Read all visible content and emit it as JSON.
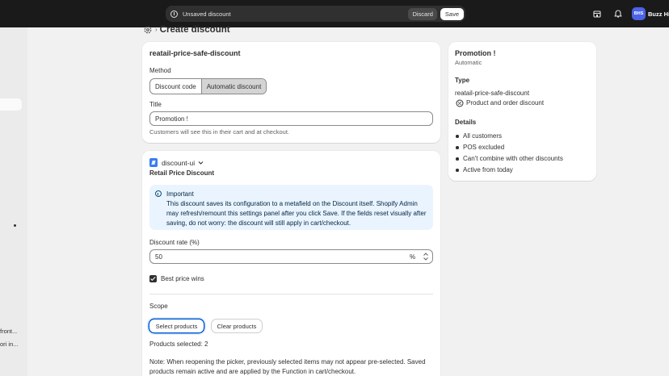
{
  "topbar": {
    "unsaved_title": "Unsaved discount",
    "discard_label": "Discard",
    "save_label": "Save",
    "avatar_initials": "BHS",
    "shop_name": "Buzz Hi"
  },
  "sidebar": {
    "snippets": [
      "front...",
      "ori in..."
    ]
  },
  "header": {
    "title": "Create discount"
  },
  "method_card": {
    "discount_name": "reatail-price-safe-discount",
    "method_label": "Method",
    "method_options": [
      "Discount code",
      "Automatic discount"
    ],
    "method_selected": "Automatic discount",
    "title_label": "Title",
    "title_value": "Promotion !",
    "title_help": "Customers will see this in their cart and at checkout."
  },
  "app_card": {
    "app_name": "discount-ui",
    "heading": "Retail Price Discount",
    "banner_title": "Important",
    "banner_text": "This discount saves its configuration to a metafield on the Discount itself. Shopify Admin may refresh/remount this settings panel after you click Save. If the fields reset visually after saving, do not worry: the discount will still apply in cart/checkout.",
    "rate_label": "Discount rate (%)",
    "rate_value": "50",
    "rate_suffix": "%",
    "best_price_label": "Best price wins",
    "best_price_checked": true,
    "scope_label": "Scope",
    "select_products_label": "Select products",
    "clear_products_label": "Clear products",
    "products_selected": "Products selected: 2",
    "note": "Note: When reopening the picker, previously selected items may not appear pre-selected. Saved products remain active and are applied by the Function in cart/checkout."
  },
  "summary": {
    "title": "Promotion !",
    "subtitle": "Automatic",
    "type_heading": "Type",
    "type_name": "reatail-price-safe-discount",
    "type_kind": "Product and order discount",
    "details_heading": "Details",
    "details": [
      "All customers",
      "POS excluded",
      "Can't combine with other discounts",
      "Active from today"
    ]
  },
  "colors": {
    "topbar": "#1a1a1a",
    "background": "#f1f1f1",
    "card": "#ffffff",
    "banner": "#eaf4ff",
    "avatar": "#4a63e7",
    "focus": "#005bd3"
  }
}
